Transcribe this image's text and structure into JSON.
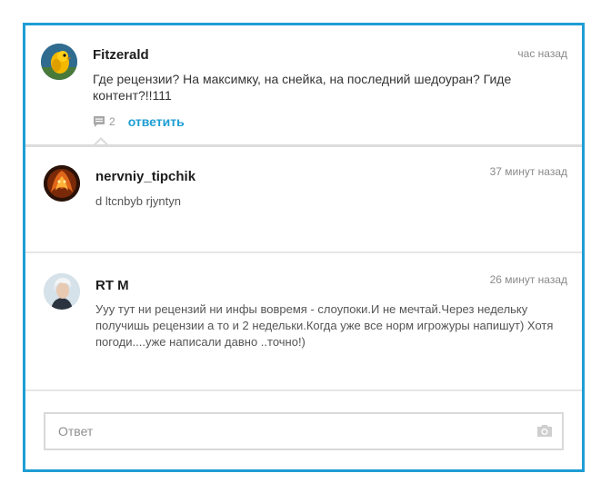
{
  "comments": [
    {
      "author": "Fitzerald",
      "time": "час назад",
      "text": "Где рецензии? На максимку, на снейка, на последний шедоуран? Гиде контент?!!111",
      "reply_count": "2",
      "reply_label": "ответить",
      "avatar_icon": "yellow-bird-avatar"
    },
    {
      "author": "nervniy_tipchik",
      "time": "37 минут назад",
      "text": "d ltcnbyb rjyntyn",
      "avatar_icon": "fire-dragon-avatar"
    },
    {
      "author": "RT M",
      "time": "26 минут назад",
      "text": "Ууу тут ни рецензий ни инфы вовремя - слоупоки.И не мечтай.Через недельку получишь рецензии а то и 2 недельки.Когда уже все норм игрожуры напишут) Хотя погоди....уже написали давно ..точно!)",
      "avatar_icon": "white-hair-character-avatar"
    }
  ],
  "reply_input": {
    "placeholder": "Ответ",
    "value": ""
  },
  "colors": {
    "accent": "#1e9ed4",
    "border": "#1e9ed4"
  }
}
